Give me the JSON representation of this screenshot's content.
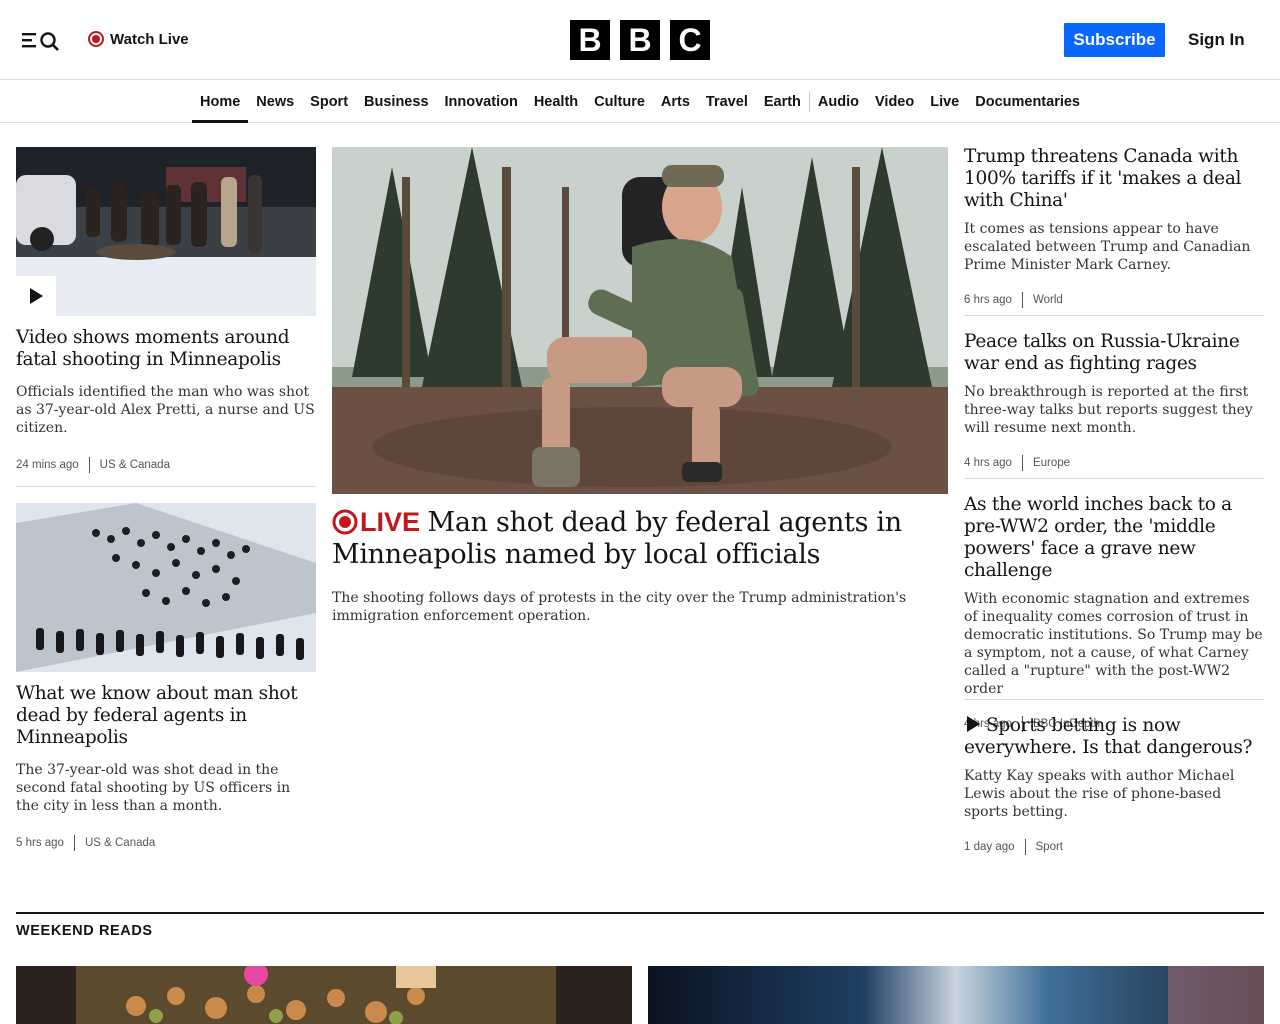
{
  "header": {
    "watch_live": "Watch Live",
    "logo_letters": [
      "B",
      "B",
      "C"
    ],
    "subscribe": "Subscribe",
    "sign_in": "Sign In",
    "accent_color": "#0a67ff",
    "live_color": "#c2181b"
  },
  "nav": {
    "items": [
      "Home",
      "News",
      "Sport",
      "Business",
      "Innovation",
      "Health",
      "Culture",
      "Arts",
      "Travel",
      "Earth",
      "Audio",
      "Video",
      "Live",
      "Documentaries"
    ],
    "active": "Home"
  },
  "left": {
    "story1": {
      "headline": "Video shows moments around fatal shooting in Minneapolis",
      "summary": "Officials identified the man who was shot as 37-year-old Alex Pretti, a nurse and US citizen.",
      "time": "24 mins ago",
      "section": "US & Canada",
      "icon": "play-icon"
    },
    "story2": {
      "headline": "What we know about man shot dead by federal agents in Minneapolis",
      "summary": "The 37-year-old was shot dead in the second fatal shooting by US officers in the city in less than a month.",
      "time": "5 hrs ago",
      "section": "US & Canada"
    }
  },
  "main": {
    "live_label": "LIVE",
    "headline": "Man shot dead by federal agents in Minneapolis named by local officials",
    "summary": "The shooting follows days of protests in the city over the Trump administration's immigration enforcement operation."
  },
  "right": {
    "items": [
      {
        "headline": "Trump threatens Canada with 100% tariffs if it 'makes a deal with China'",
        "summary": "It comes as tensions appear to have escalated between Trump and Canadian Prime Minister Mark Carney.",
        "time": "6 hrs ago",
        "section": "World"
      },
      {
        "headline": "Peace talks on Russia-Ukraine war end as fighting rages",
        "summary": "No breakthrough is reported at the first three-way talks but reports suggest they will resume next month.",
        "time": "4 hrs ago",
        "section": "Europe"
      },
      {
        "headline": "As the world inches back to a pre-WW2 order, the 'middle powers' face a grave new challenge",
        "summary": "With economic stagnation and extremes of inequality comes corrosion of trust in democratic institutions. So Trump may be a symptom, not a cause, of what Carney called a \"rupture\" with the post-WW2 order",
        "time": "4 hrs ago",
        "section": "BBC InDepth"
      },
      {
        "headline": "Sports betting is now everywhere. Is that dangerous?",
        "summary": "Katty Kay speaks with author Michael Lewis about the rise of phone-based sports betting.",
        "time": "1 day ago",
        "section": "Sport",
        "icon": "play-icon"
      }
    ]
  },
  "weekend": {
    "title": "WEEKEND READS"
  }
}
